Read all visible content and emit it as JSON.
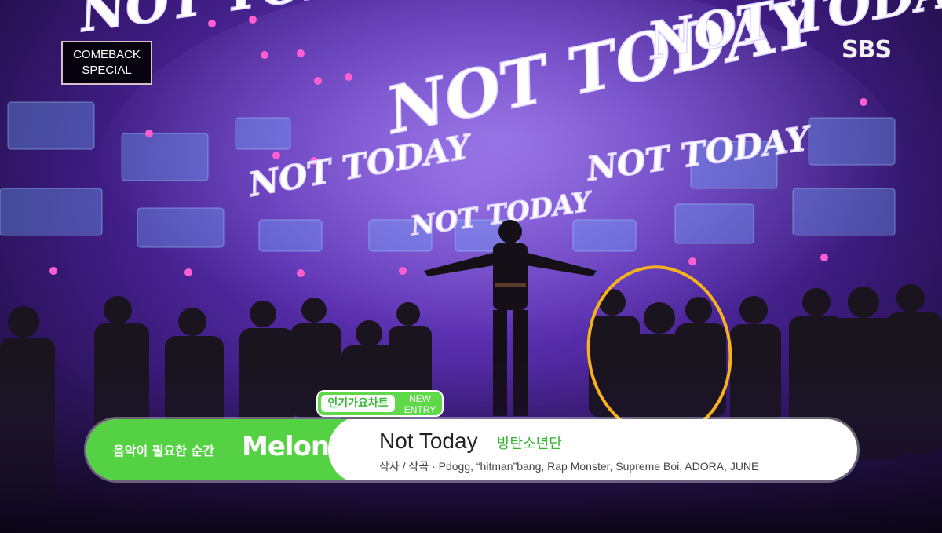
{
  "broadcast": {
    "corner_label_line1": "COMEBACK",
    "corner_label_line2": "SPECIAL",
    "network_logo": "SBS"
  },
  "stage": {
    "sign_text": "NOT TODAY"
  },
  "chart_tag": {
    "chart_name": "인기가요차트",
    "status_line1": "NEW",
    "status_line2": "ENTRY"
  },
  "lower_third": {
    "tagline": "음악이 필요한 순간",
    "brand": "Melon",
    "song_title": "Not Today",
    "artist": "방탄소년단",
    "credits": "작사 / 작곡 · Pdogg, “hitman”bang, Rap Monster, Supreme Boi, ADORA, JUNE"
  },
  "colors": {
    "chart_green": "#55d243",
    "highlight_circle": "#f6b21d",
    "stage_purple": "#5a2fb0"
  }
}
